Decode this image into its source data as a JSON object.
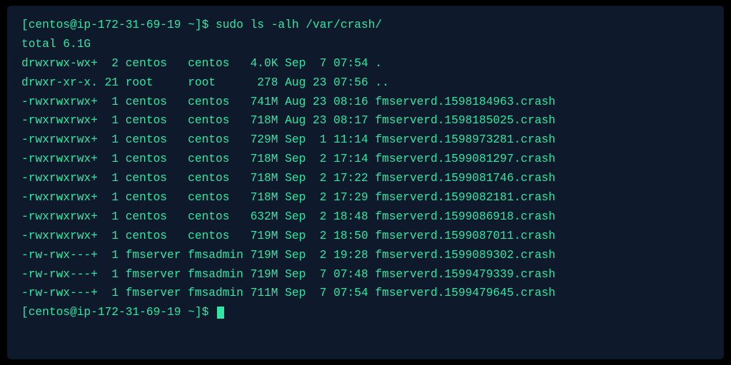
{
  "terminal": {
    "prompt": "[centos@ip-172-31-69-19 ~]$ ",
    "command": "sudo ls -alh /var/crash/",
    "total_line": "total 6.1G",
    "rows": [
      {
        "perm": "drwxrwx-wx+",
        "links": " 2",
        "owner": "centos  ",
        "group": "centos  ",
        "size": " 4.0K",
        "month": "Sep",
        "day": " 7",
        "time": "07:54",
        "name": "."
      },
      {
        "perm": "drwxr-xr-x.",
        "links": "21",
        "owner": "root    ",
        "group": "root    ",
        "size": "  278",
        "month": "Aug",
        "day": "23",
        "time": "07:56",
        "name": ".."
      },
      {
        "perm": "-rwxrwxrwx+",
        "links": " 1",
        "owner": "centos  ",
        "group": "centos  ",
        "size": " 741M",
        "month": "Aug",
        "day": "23",
        "time": "08:16",
        "name": "fmserverd.1598184963.crash"
      },
      {
        "perm": "-rwxrwxrwx+",
        "links": " 1",
        "owner": "centos  ",
        "group": "centos  ",
        "size": " 718M",
        "month": "Aug",
        "day": "23",
        "time": "08:17",
        "name": "fmserverd.1598185025.crash"
      },
      {
        "perm": "-rwxrwxrwx+",
        "links": " 1",
        "owner": "centos  ",
        "group": "centos  ",
        "size": " 729M",
        "month": "Sep",
        "day": " 1",
        "time": "11:14",
        "name": "fmserverd.1598973281.crash"
      },
      {
        "perm": "-rwxrwxrwx+",
        "links": " 1",
        "owner": "centos  ",
        "group": "centos  ",
        "size": " 718M",
        "month": "Sep",
        "day": " 2",
        "time": "17:14",
        "name": "fmserverd.1599081297.crash"
      },
      {
        "perm": "-rwxrwxrwx+",
        "links": " 1",
        "owner": "centos  ",
        "group": "centos  ",
        "size": " 718M",
        "month": "Sep",
        "day": " 2",
        "time": "17:22",
        "name": "fmserverd.1599081746.crash"
      },
      {
        "perm": "-rwxrwxrwx+",
        "links": " 1",
        "owner": "centos  ",
        "group": "centos  ",
        "size": " 718M",
        "month": "Sep",
        "day": " 2",
        "time": "17:29",
        "name": "fmserverd.1599082181.crash"
      },
      {
        "perm": "-rwxrwxrwx+",
        "links": " 1",
        "owner": "centos  ",
        "group": "centos  ",
        "size": " 632M",
        "month": "Sep",
        "day": " 2",
        "time": "18:48",
        "name": "fmserverd.1599086918.crash"
      },
      {
        "perm": "-rwxrwxrwx+",
        "links": " 1",
        "owner": "centos  ",
        "group": "centos  ",
        "size": " 719M",
        "month": "Sep",
        "day": " 2",
        "time": "18:50",
        "name": "fmserverd.1599087011.crash"
      },
      {
        "perm": "-rw-rwx---+",
        "links": " 1",
        "owner": "fmserver",
        "group": "fmsadmin",
        "size": " 719M",
        "month": "Sep",
        "day": " 2",
        "time": "19:28",
        "name": "fmserverd.1599089302.crash"
      },
      {
        "perm": "-rw-rwx---+",
        "links": " 1",
        "owner": "fmserver",
        "group": "fmsadmin",
        "size": " 719M",
        "month": "Sep",
        "day": " 7",
        "time": "07:48",
        "name": "fmserverd.1599479339.crash"
      },
      {
        "perm": "-rw-rwx---+",
        "links": " 1",
        "owner": "fmserver",
        "group": "fmsadmin",
        "size": " 711M",
        "month": "Sep",
        "day": " 7",
        "time": "07:54",
        "name": "fmserverd.1599479645.crash"
      }
    ]
  }
}
